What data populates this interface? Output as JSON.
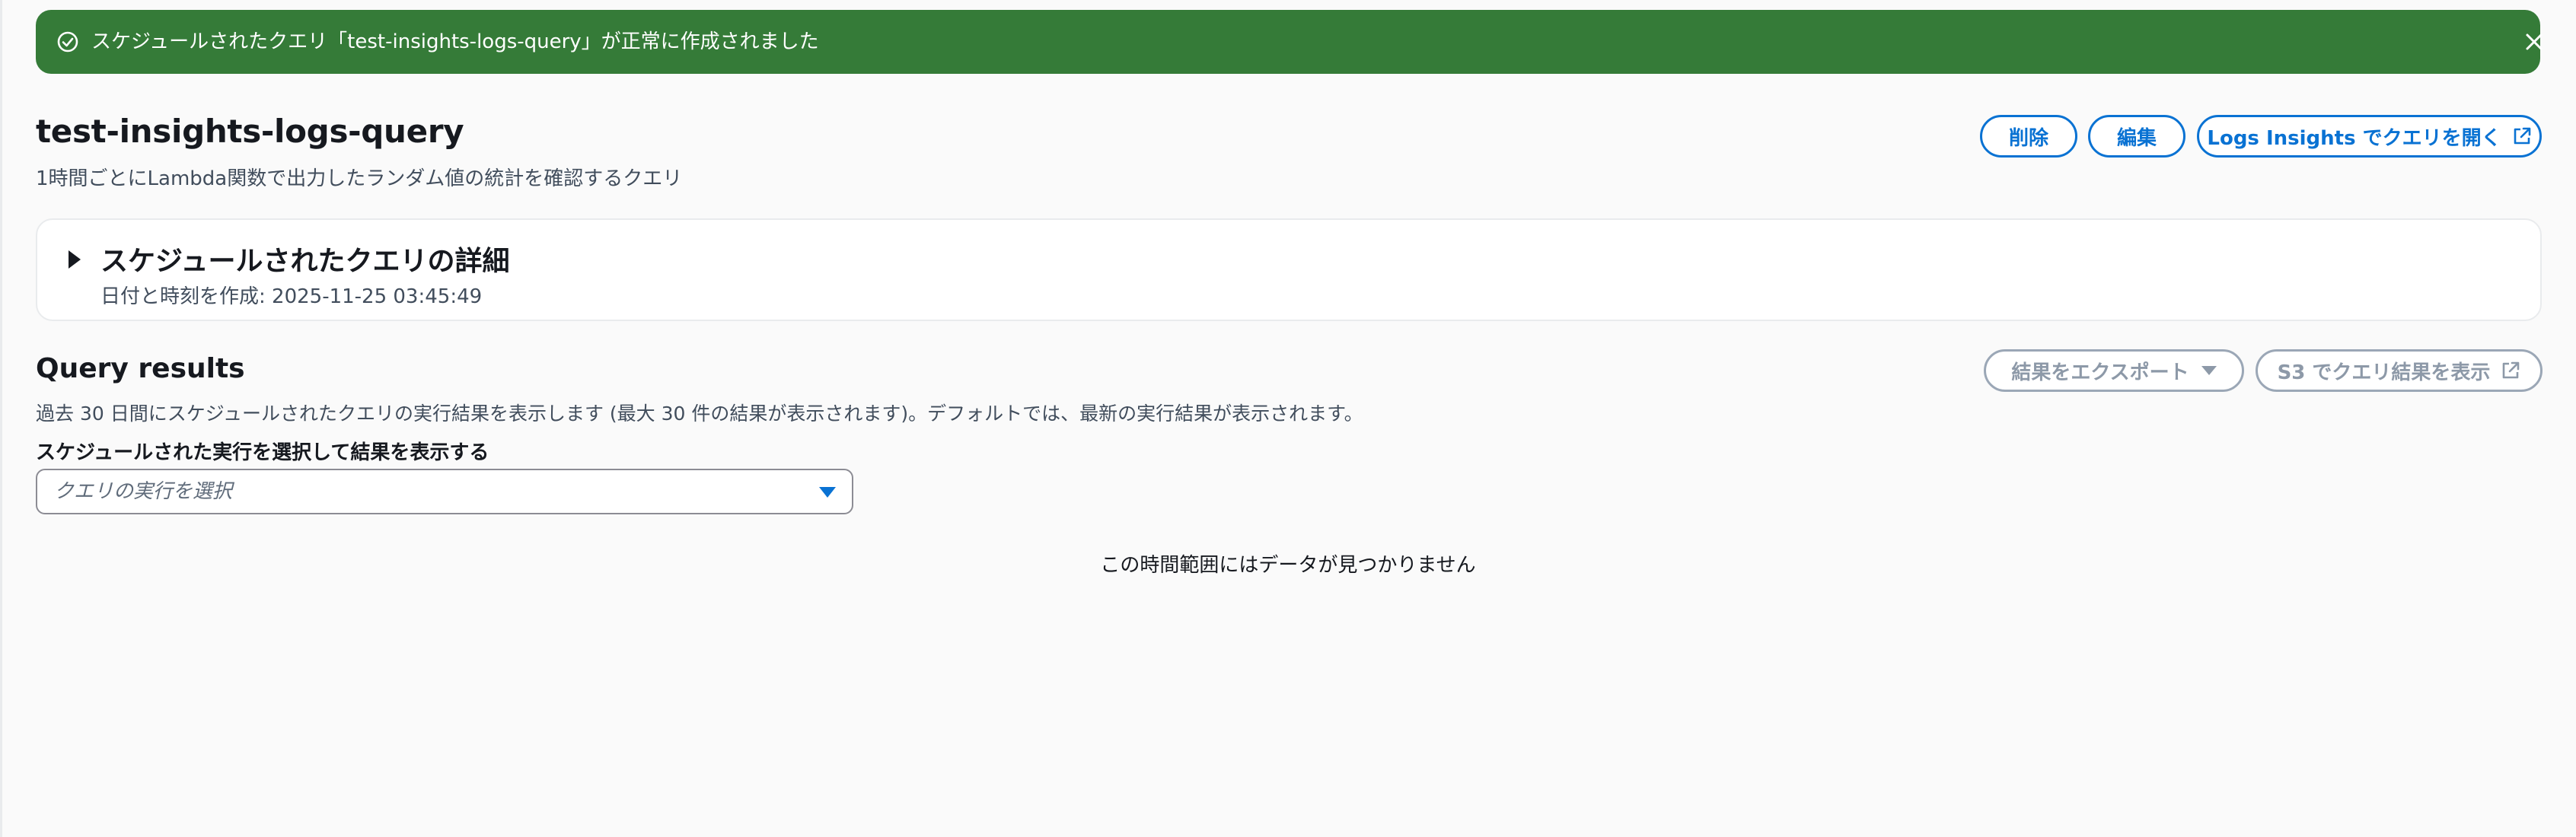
{
  "flash": {
    "message": "スケジュールされたクエリ「test-insights-logs-query」が正常に作成されました",
    "type": "success",
    "color": "#357b38",
    "icons": {
      "status": "check-circle-icon",
      "dismiss": "close-icon"
    }
  },
  "header": {
    "title": "test-insights-logs-query",
    "description": "1時間ごとにLambda関数で出力したランダム値の統計を確認するクエリ",
    "buttons": {
      "delete": "削除",
      "edit": "編集",
      "open_logs_insights": "Logs Insights でクエリを開く",
      "open_icon": "external-link-icon"
    }
  },
  "details": {
    "title": "スケジュールされたクエリの詳細",
    "created": "日付と時刻を作成: 2025-11-25 03:45:49",
    "expanded": false
  },
  "results": {
    "title": "Query results",
    "description": "過去 30 日間にスケジュールされたクエリの実行結果を表示します (最大 30 件の結果が表示されます)。デフォルトでは、最新の実行結果が表示されます。",
    "export_button": "結果をエクスポート",
    "s3_button": "S3 でクエリ結果を表示",
    "select_label": "スケジュールされた実行を選択して結果を表示する",
    "select_placeholder": "クエリの実行を選択",
    "empty_message": "この時間範囲にはデータが見つかりません"
  },
  "colors": {
    "accent": "#0972d3",
    "success": "#357b38",
    "disabled": "#8d99a8"
  }
}
